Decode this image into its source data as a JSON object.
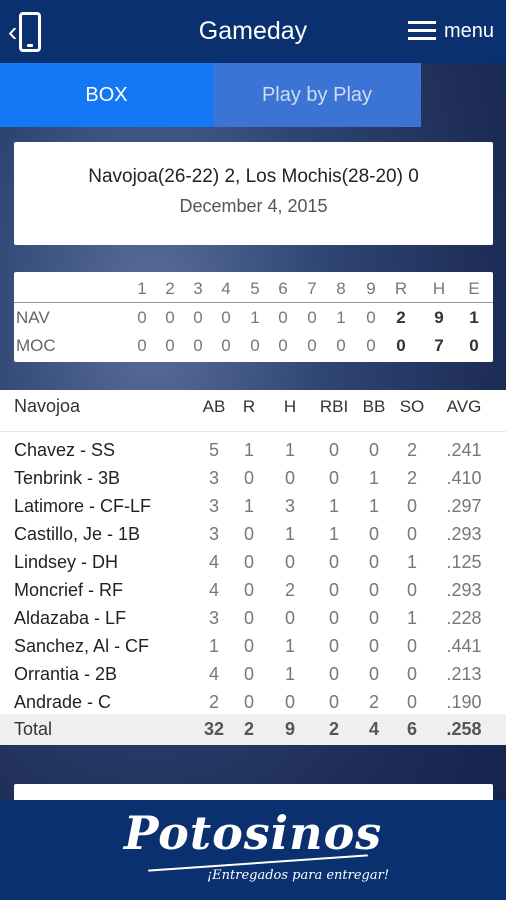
{
  "header": {
    "title": "Gameday",
    "menu_label": "menu"
  },
  "tabs": [
    {
      "label": "BOX"
    },
    {
      "label": "Play by Play"
    }
  ],
  "game": {
    "matchup": "Navojoa(26-22) 2, Los Mochis(28-20) 0",
    "date": "December 4, 2015"
  },
  "linescore": {
    "headers": [
      "1",
      "2",
      "3",
      "4",
      "5",
      "6",
      "7",
      "8",
      "9",
      "R",
      "H",
      "E"
    ],
    "teams": [
      {
        "name": "NAV",
        "innings": [
          "0",
          "0",
          "0",
          "0",
          "1",
          "0",
          "0",
          "1",
          "0"
        ],
        "r": "2",
        "h": "9",
        "e": "1"
      },
      {
        "name": "MOC",
        "innings": [
          "0",
          "0",
          "0",
          "0",
          "0",
          "0",
          "0",
          "0",
          "0"
        ],
        "r": "0",
        "h": "7",
        "e": "0"
      }
    ]
  },
  "boxscore": {
    "team": "Navojoa",
    "columns": [
      "AB",
      "R",
      "H",
      "RBI",
      "BB",
      "SO",
      "AVG"
    ],
    "players": [
      {
        "name": "Chavez - SS",
        "stats": [
          "5",
          "1",
          "1",
          "0",
          "0",
          "2",
          ".241"
        ]
      },
      {
        "name": "Tenbrink - 3B",
        "stats": [
          "3",
          "0",
          "0",
          "0",
          "1",
          "2",
          ".410"
        ]
      },
      {
        "name": "Latimore - CF-LF",
        "stats": [
          "3",
          "1",
          "3",
          "1",
          "1",
          "0",
          ".297"
        ]
      },
      {
        "name": "Castillo, Je - 1B",
        "stats": [
          "3",
          "0",
          "1",
          "1",
          "0",
          "0",
          ".293"
        ]
      },
      {
        "name": "Lindsey - DH",
        "stats": [
          "4",
          "0",
          "0",
          "0",
          "0",
          "1",
          ".125"
        ]
      },
      {
        "name": "Moncrief - RF",
        "stats": [
          "4",
          "0",
          "2",
          "0",
          "0",
          "0",
          ".293"
        ]
      },
      {
        "name": "Aldazaba - LF",
        "stats": [
          "3",
          "0",
          "0",
          "0",
          "0",
          "1",
          ".228"
        ]
      },
      {
        "name": "Sanchez, Al - CF",
        "stats": [
          "1",
          "0",
          "1",
          "0",
          "0",
          "0",
          ".441"
        ]
      },
      {
        "name": "Orrantia - 2B",
        "stats": [
          "4",
          "0",
          "1",
          "0",
          "0",
          "0",
          ".213"
        ]
      },
      {
        "name": "Andrade - C",
        "stats": [
          "2",
          "0",
          "0",
          "0",
          "2",
          "0",
          ".190"
        ]
      }
    ],
    "total": {
      "label": "Total",
      "stats": [
        "32",
        "2",
        "9",
        "2",
        "4",
        "6",
        ".258"
      ]
    }
  },
  "footer": {
    "logo_text": "Potosinos",
    "slogan": "¡Entregados para entregar!"
  },
  "colors": {
    "header_bg": "#0b3070",
    "tab_active": "#1478f4",
    "tab_inactive": "#3b74d4"
  },
  "icons": {
    "back": "phone-back-icon",
    "menu": "hamburger-icon"
  }
}
